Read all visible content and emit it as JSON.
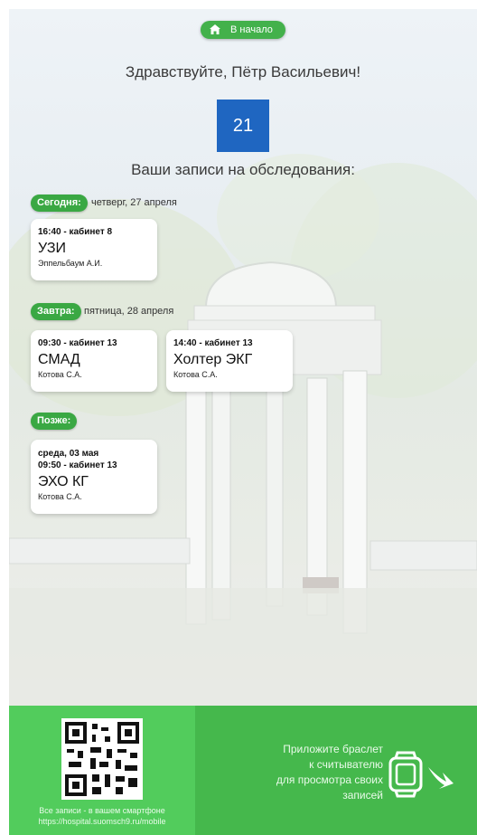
{
  "header": {
    "home_label": "В начало",
    "home_icon": "home-icon"
  },
  "greeting": "Здравствуйте, Пётр Васильевич!",
  "day_number": "21",
  "records_title": "Ваши записи на обследования:",
  "groups": [
    {
      "tag": "Сегодня:",
      "date": "четверг, 27 апреля",
      "cards": [
        {
          "time": "16:40 - кабинет 8",
          "exam": "УЗИ",
          "doctor": "Эппельбаум А.И."
        }
      ]
    },
    {
      "tag": "Завтра:",
      "date": "пятница, 28 апреля",
      "cards": [
        {
          "time": "09:30 - кабинет 13",
          "exam": "СМАД",
          "doctor": "Котова С.А."
        },
        {
          "time": "14:40 - кабинет 13",
          "exam": "Холтер ЭКГ",
          "doctor": "Котова С.А."
        }
      ]
    },
    {
      "tag": "Позже:",
      "date": "",
      "cards": [
        {
          "date": "среда, 03 мая",
          "time": "09:50 - кабинет 13",
          "exam": "ЭХО КГ",
          "doctor": "Котова С.А."
        }
      ]
    }
  ],
  "footer": {
    "mobile_line1": "Все записи - в вашем смартфоне",
    "mobile_line2": "https://hospital.suomsch9.ru/mobile",
    "bracelet_line1": "Приложите браслет",
    "bracelet_line2": "к считывателю",
    "bracelet_line3": "для просмотра своих",
    "bracelet_line4": "записей",
    "bracelet_icon": "smartwatch-icon",
    "arrow_icon": "arrow-curve-icon",
    "qr_icon": "qr-code-icon"
  },
  "colors": {
    "accent_green": "#3aa843",
    "day_blue": "#1f66c1",
    "footer_left": "#52cc5c",
    "footer_right": "#45b84c"
  }
}
